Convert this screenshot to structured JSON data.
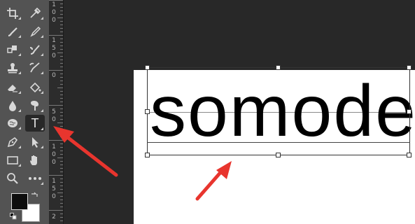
{
  "toolbar": {
    "tools": [
      {
        "name": "crop-icon",
        "group": 1
      },
      {
        "name": "eyedropper-icon",
        "group": 1
      },
      {
        "name": "healing-brush-icon"
      },
      {
        "name": "brush-icon"
      },
      {
        "name": "patch-tool-icon"
      },
      {
        "name": "mixer-brush-icon"
      },
      {
        "name": "stamp-icon"
      },
      {
        "name": "history-brush-icon"
      },
      {
        "name": "eraser-icon"
      },
      {
        "name": "paint-bucket-icon"
      },
      {
        "name": "blur-drop-icon"
      },
      {
        "name": "smudge-icon"
      },
      {
        "name": "brain-sponge-icon"
      },
      {
        "name": "type-tool-icon",
        "label": "T",
        "selected": true
      },
      {
        "name": "pen-icon"
      },
      {
        "name": "path-select-icon"
      },
      {
        "name": "rectangle-icon"
      },
      {
        "name": "hand-icon"
      },
      {
        "name": "zoom-icon"
      },
      {
        "name": "more-tools-icon"
      }
    ],
    "foreground_color": "#0d0d0d",
    "background_color": "#ffffff"
  },
  "ruler": {
    "labels": [
      "1\n0\n0",
      "1\n5\n0",
      "0",
      "5\n0",
      "1\n0\n0",
      "1\n5\n0",
      "2"
    ]
  },
  "canvas": {
    "text": "somode",
    "text_color": "#000000",
    "document_color": "#ffffff"
  },
  "annotations": {
    "arrow_color": "#e8352e"
  }
}
